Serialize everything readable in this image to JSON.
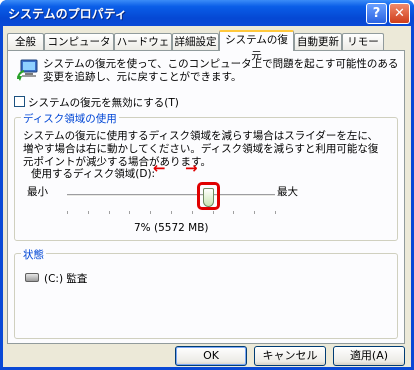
{
  "window": {
    "title": "システムのプロパティ",
    "help_glyph": "?",
    "close_glyph": "✕"
  },
  "tabs": [
    {
      "label": "全般",
      "active": false
    },
    {
      "label": "コンピュータ名",
      "active": false
    },
    {
      "label": "ハードウェア",
      "active": false
    },
    {
      "label": "詳細設定",
      "active": false
    },
    {
      "label": "システムの復元",
      "active": true
    },
    {
      "label": "自動更新",
      "active": false
    },
    {
      "label": "リモート",
      "active": false
    }
  ],
  "intro": "システムの復元を使って、このコンピュータ上で問題を起こす可能性のある変更を追跡し、元に戻すことができます。",
  "disable_checkbox": {
    "label": "システムの復元を無効にする(T)",
    "checked": false
  },
  "disk_group": {
    "title": "ディスク領域の使用",
    "description": "システムの復元に使用するディスク領域を減らす場合はスライダーを左に、増やす場合は右に動かしてください。ディスク領域を減らすと利用可能な復元ポイントが減少する場合があります。",
    "usage_label": "使用するディスク領域(D):",
    "min_label": "最小",
    "max_label": "最大",
    "value_text": "7% (5572 MB)",
    "slider_fraction": 0.68,
    "arrow_left": "←",
    "arrow_right": "→"
  },
  "status_group": {
    "title": "状態",
    "drive_text": "(C:) 監査"
  },
  "buttons": {
    "ok": "OK",
    "cancel": "キャンセル",
    "apply": "適用(A)"
  },
  "colors": {
    "title_bar": "#0a49d6",
    "group_title": "#0046d5",
    "highlight": "#e00000"
  }
}
